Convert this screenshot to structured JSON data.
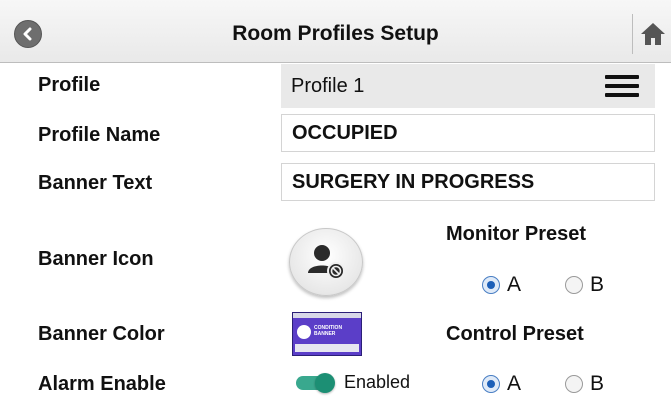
{
  "header": {
    "title": "Room Profiles Setup",
    "back_icon": "chevron-left-icon",
    "home_icon": "home-icon"
  },
  "labels": {
    "profile": "Profile",
    "profile_name": "Profile Name",
    "banner_text": "Banner Text",
    "banner_icon": "Banner Icon",
    "banner_color": "Banner Color",
    "alarm_enable": "Alarm Enable"
  },
  "profile_select": {
    "value": "Profile 1",
    "menu_icon": "hamburger-menu-icon"
  },
  "profile_name": {
    "value": "OCCUPIED"
  },
  "banner_text": {
    "value": "SURGERY IN PROGRESS"
  },
  "banner_icon": {
    "icon": "person-blocked-icon"
  },
  "banner_color": {
    "thumb_text": "CONDITION BANNER",
    "color": "#5b3ec8"
  },
  "monitor_preset": {
    "title": "Monitor Preset",
    "options": [
      "A",
      "B"
    ],
    "selected": "A"
  },
  "control_preset": {
    "title": "Control Preset",
    "options": [
      "A",
      "B"
    ],
    "selected": "A"
  },
  "alarm": {
    "label": "Enabled",
    "on": true,
    "color": "#39a88e"
  }
}
